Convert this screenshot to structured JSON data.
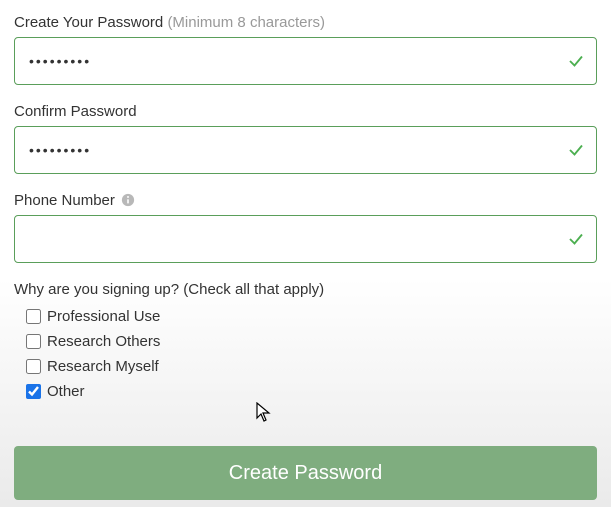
{
  "fields": {
    "password": {
      "label": "Create Your Password",
      "hint": "(Minimum 8 characters)",
      "value": "•••••••••"
    },
    "confirm": {
      "label": "Confirm Password",
      "value": "•••••••••"
    },
    "phone": {
      "label": "Phone Number",
      "value": ""
    }
  },
  "question": {
    "label": "Why are you signing up?",
    "hint": "(Check all that apply)",
    "options": [
      {
        "label": "Professional Use",
        "checked": false
      },
      {
        "label": "Research Others",
        "checked": false
      },
      {
        "label": "Research Myself",
        "checked": false
      },
      {
        "label": "Other",
        "checked": true
      }
    ]
  },
  "submit": {
    "label": "Create Password"
  },
  "colors": {
    "accent_border": "#5a9e5a",
    "button_bg": "#7fad7f",
    "check": "#4caf50"
  }
}
